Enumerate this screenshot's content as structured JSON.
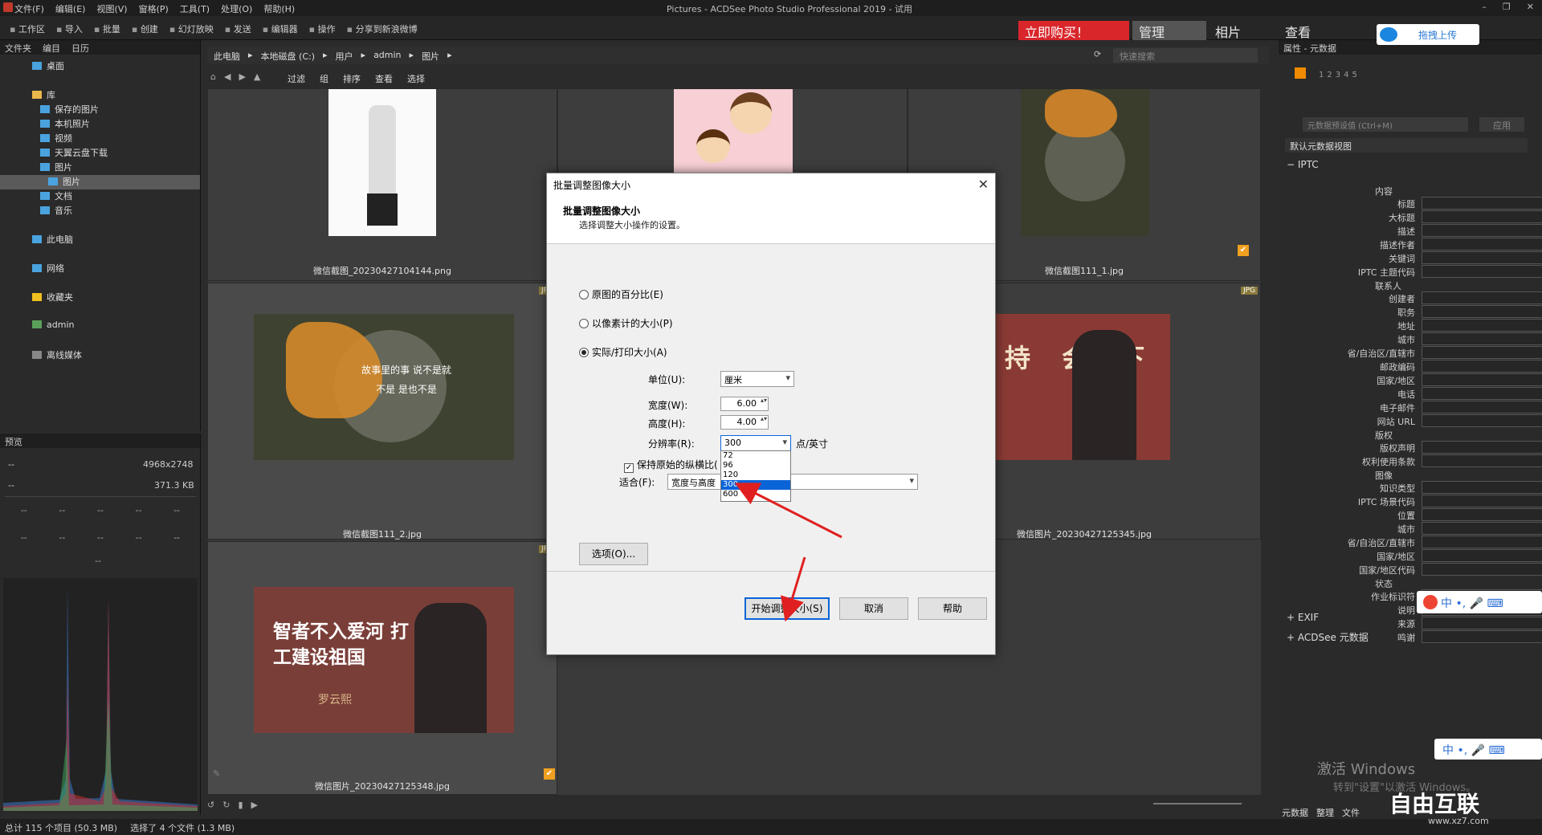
{
  "window": {
    "title": "Pictures - ACDSee Photo Studio Professional 2019 - 试用",
    "menu": [
      "文件(F)",
      "编辑(E)",
      "视图(V)",
      "窗格(P)",
      "工具(T)",
      "处理(O)",
      "帮助(H)"
    ]
  },
  "toolbar": {
    "tools": [
      "工作区",
      "导入",
      "批量",
      "创建",
      "幻灯放映",
      "发送",
      "编辑器",
      "操作",
      "分享到新浪微博"
    ],
    "buy_now": "立即购买！",
    "modes": [
      "管理",
      "相片",
      "查看"
    ],
    "upload": "拖拽上传"
  },
  "folder_pane": {
    "tabs": [
      "文件夹",
      "编目",
      "日历"
    ],
    "items": [
      {
        "label": "桌面",
        "level": 1
      },
      {
        "label": "库",
        "level": 1
      },
      {
        "label": "保存的图片",
        "level": 2
      },
      {
        "label": "本机照片",
        "level": 2
      },
      {
        "label": "视频",
        "level": 2
      },
      {
        "label": "天翼云盘下载",
        "level": 2
      },
      {
        "label": "图片",
        "level": 2
      },
      {
        "label": "图片",
        "level": 3,
        "selected": true
      },
      {
        "label": "文档",
        "level": 2
      },
      {
        "label": "音乐",
        "level": 2
      },
      {
        "label": "此电脑",
        "level": 1
      },
      {
        "label": "网络",
        "level": 1
      },
      {
        "label": "收藏夹",
        "level": 1
      },
      {
        "label": "admin",
        "level": 1
      },
      {
        "label": "离线媒体",
        "level": 1
      }
    ]
  },
  "preview_pane": {
    "title": "预览",
    "dimensions": "4968x2748",
    "filesize": "371.3 KB",
    "placeholder": "--"
  },
  "address": {
    "crumbs": [
      "此电脑",
      "本地磁盘 (C:)",
      "用户",
      "admin",
      "图片"
    ],
    "search_placeholder": "快速搜索"
  },
  "filterbar": {
    "items": [
      "过滤",
      "组",
      "排序",
      "查看",
      "选择"
    ]
  },
  "thumbnails": [
    {
      "caption": "微信截图_20230427104144.png",
      "tag": ""
    },
    {
      "caption": "",
      "tag": ""
    },
    {
      "caption": "微信截图111_1.jpg",
      "tag": ""
    },
    {
      "caption": "微信截图111_2.jpg",
      "tag": "JPG",
      "overlay": "故事里的事 说不是就不是 是也不是"
    },
    {
      "caption": "",
      "tag": ""
    },
    {
      "caption": "微信图片_20230427125345.jpg",
      "tag": "JPG",
      "overlay": "坚持 会 下班"
    },
    {
      "caption": "微信图片_20230427125348.jpg",
      "tag": "JPG",
      "overlay": "智者不入爱河 打工建设祖国",
      "overlay_sub": "罗云熙"
    }
  ],
  "dialog": {
    "title": "批量调整图像大小",
    "heading": "批量调整图像大小",
    "subheading": "选择调整大小操作的设置。",
    "options": [
      "原图的百分比(E)",
      "以像素计的大小(P)",
      "实际/打印大小(A)"
    ],
    "unit_label": "单位(U):",
    "unit_value": "厘米",
    "width_label": "宽度(W):",
    "width_value": "6.00",
    "height_label": "高度(H):",
    "height_value": "4.00",
    "resolution_label": "分辨率(R):",
    "resolution_value": "300",
    "resolution_unit": "点/英寸",
    "resolution_options": [
      "72",
      "96",
      "120",
      "300",
      "600"
    ],
    "keep_ratio_label": "保持原始的纵横比(",
    "fit_label": "适合(F):",
    "fit_value": "宽度与高度",
    "options_button": "选项(O)...",
    "start_button": "开始调整大小(S)",
    "cancel_button": "取消",
    "help_button": "帮助"
  },
  "properties": {
    "title": "属性 - 元数据",
    "preset_placeholder": "元数据预设值 (Ctrl+M)",
    "apply": "应用",
    "view": "默认元数据视图",
    "iptc": "IPTC",
    "sections": {
      "content": "内容",
      "contact": "联系人",
      "copyright": "版权",
      "image": "图像",
      "status": "状态"
    },
    "content_fields": [
      "标题",
      "大标题",
      "描述",
      "描述作者",
      "关键词",
      "IPTC 主题代码"
    ],
    "contact_fields": [
      "创建者",
      "职务",
      "地址",
      "城市",
      "省/自治区/直辖市",
      "邮政编码",
      "国家/地区",
      "电话",
      "电子邮件",
      "网站 URL"
    ],
    "copyright_fields": [
      "版权声明",
      "权利使用条款"
    ],
    "image_fields": [
      "知识类型",
      "IPTC 场景代码",
      "位置",
      "城市",
      "省/自治区/直辖市",
      "国家/地区",
      "国家/地区代码"
    ],
    "status_fields": [
      "作业标识符",
      "说明",
      "来源",
      "鸣谢"
    ],
    "exif": "EXIF",
    "acdsee_meta": "ACDSee 元数据",
    "bottom_tabs": [
      "元数据",
      "整理",
      "文件"
    ]
  },
  "status": {
    "total": "总计 115 个项目 (50.3 MB)",
    "selected": "选择了 4 个文件 (1.3 MB)"
  },
  "watermark": {
    "line1": "激活 Windows",
    "line2": "转到\"设置\"以激活 Windows。",
    "site": "自由互联",
    "url": "www.xz7.com"
  },
  "colors": {
    "accent": "#0a64d8",
    "buy": "#d8262b",
    "arrow": "#e02020"
  }
}
